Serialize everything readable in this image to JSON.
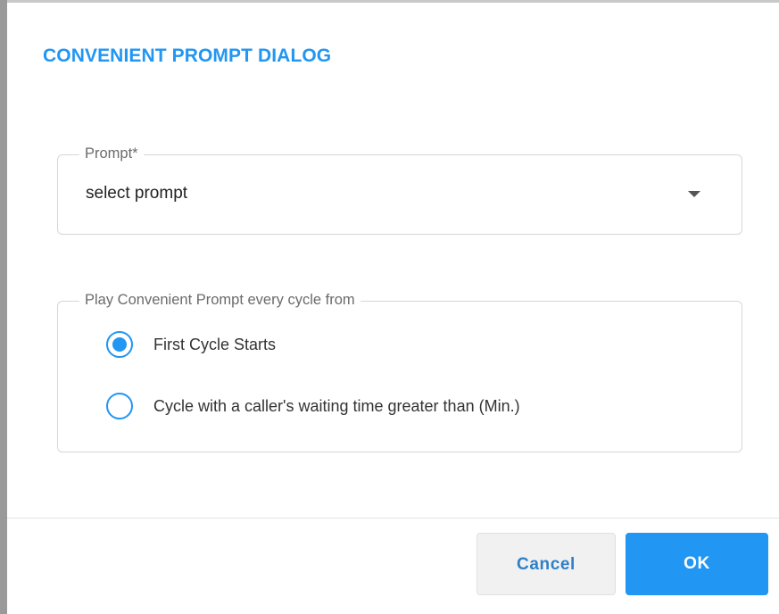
{
  "dialog": {
    "title": "CONVENIENT PROMPT DIALOG",
    "accent_color": "#2196f3"
  },
  "prompt_field": {
    "label": "Prompt*",
    "value": "select prompt",
    "icon": "chevron-down-icon"
  },
  "cycle_group": {
    "legend": "Play Convenient Prompt every cycle from",
    "options": [
      {
        "label": "First Cycle Starts",
        "selected": true
      },
      {
        "label": "Cycle with a caller's waiting time greater than (Min.)",
        "selected": false
      }
    ]
  },
  "actions": {
    "cancel_label": "Cancel",
    "ok_label": "OK"
  }
}
